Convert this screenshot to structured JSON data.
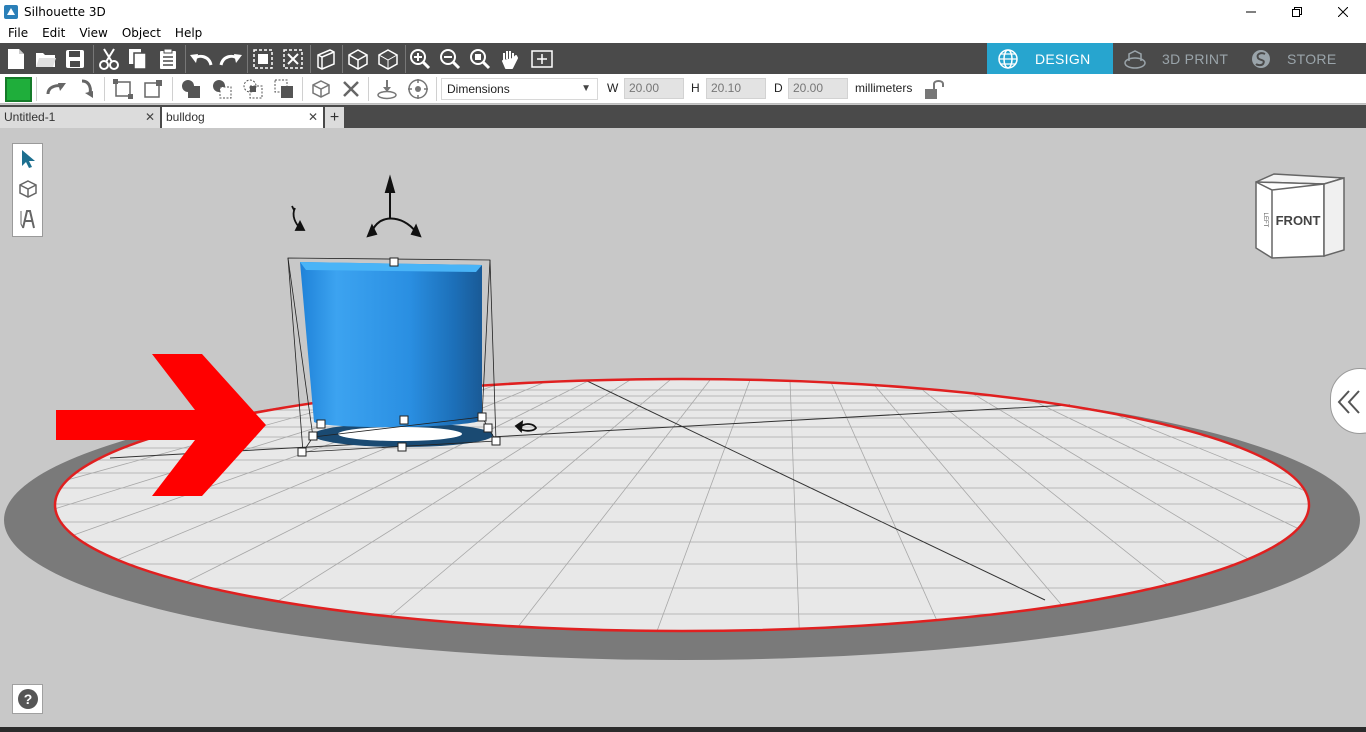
{
  "window": {
    "title": "Silhouette 3D"
  },
  "menu": [
    "File",
    "Edit",
    "View",
    "Object",
    "Help"
  ],
  "mode_tabs": [
    {
      "label": "DESIGN",
      "icon": "globe-icon",
      "active": true
    },
    {
      "label": "3D PRINT",
      "icon": "printer-icon",
      "active": false
    },
    {
      "label": "STORE",
      "icon": "store-icon",
      "active": false
    }
  ],
  "toolbar": {
    "dimension_mode": "Dimensions",
    "width_label": "W",
    "width_value": "20.00",
    "height_label": "H",
    "height_value": "20.10",
    "depth_label": "D",
    "depth_value": "20.00",
    "units": "millimeters",
    "object_color": "#1fae3b"
  },
  "doc_tabs": [
    {
      "label": "Untitled-1",
      "active": false
    },
    {
      "label": "bulldog",
      "active": true
    }
  ],
  "add_tab_label": "+",
  "viewcube": {
    "front_label": "FRONT",
    "left_label": "LEFT"
  },
  "colors": {
    "accent": "#27a5cf",
    "model": "#2f8fe6",
    "arrow": "#ff0000",
    "bed_edge": "#e02020"
  }
}
